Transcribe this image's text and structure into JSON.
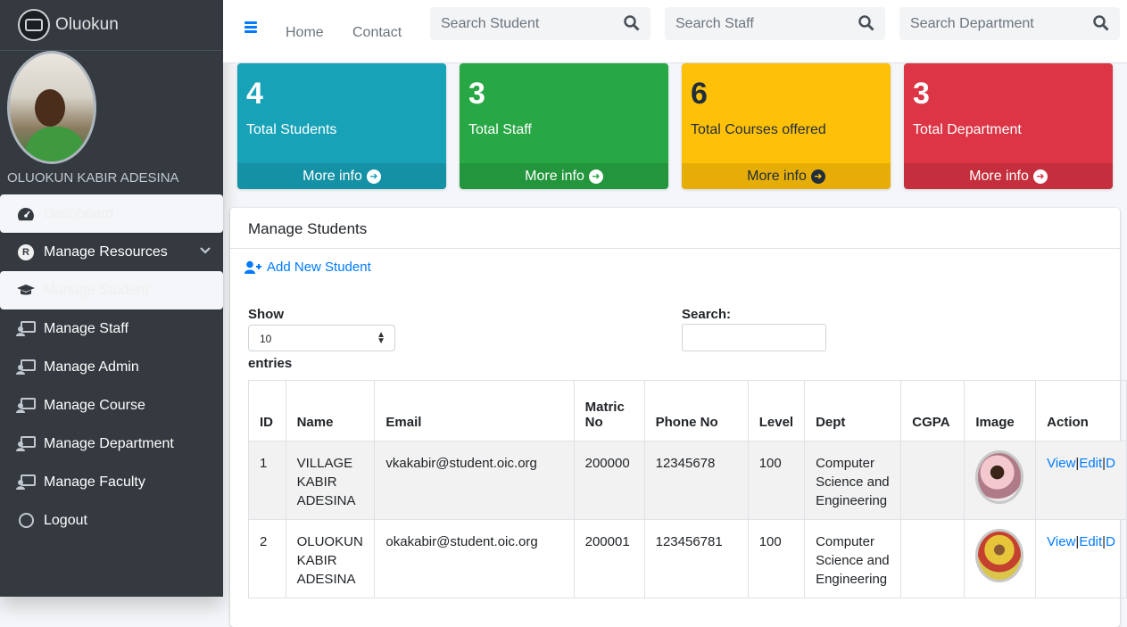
{
  "brand": {
    "name": "Oluokun"
  },
  "user": {
    "name": "OLUOKUN KABIR ADESINA"
  },
  "sidebar": {
    "items": [
      {
        "label": "Dashboard",
        "icon": "dashboard-icon"
      },
      {
        "label": "Manage Resources",
        "icon": "r-circle-icon"
      },
      {
        "label": "Manage Student",
        "icon": "graduation-cap-icon"
      },
      {
        "label": "Manage Staff",
        "icon": "chalkboard-user-icon"
      },
      {
        "label": "Manage Admin",
        "icon": "chalkboard-user-icon"
      },
      {
        "label": "Manage Course",
        "icon": "chalkboard-user-icon"
      },
      {
        "label": "Manage Department",
        "icon": "chalkboard-user-icon"
      },
      {
        "label": "Manage Faculty",
        "icon": "chalkboard-user-icon"
      },
      {
        "label": "Logout",
        "icon": "circle-icon"
      }
    ]
  },
  "topbar": {
    "links": [
      "Home",
      "Contact"
    ],
    "search_student": "Search Student",
    "search_staff": "Search Staff",
    "search_department": "Search Department"
  },
  "stats": [
    {
      "value": "4",
      "label": "Total Students",
      "more": "More info",
      "color": "#17a2b8"
    },
    {
      "value": "3",
      "label": "Total Staff",
      "more": "More info",
      "color": "#28a745"
    },
    {
      "value": "6",
      "label": "Total Courses offered",
      "more": "More info",
      "color": "#ffc107"
    },
    {
      "value": "3",
      "label": "Total Department",
      "more": "More info",
      "color": "#dc3545"
    }
  ],
  "card": {
    "title": "Manage Students",
    "add_label": "Add New Student",
    "show_label": "Show",
    "entries_label": "entries",
    "page_size": "10",
    "search_label": "Search:"
  },
  "table": {
    "headers": [
      "ID",
      "Name",
      "Email",
      "Matric No",
      "Phone No",
      "Level",
      "Dept",
      "CGPA",
      "Image",
      "Action"
    ],
    "rows": [
      {
        "id": "1",
        "name": "VILLAGE KABIR ADESINA",
        "email": "vkakabir@student.oic.org",
        "matric": "200000",
        "phone": "12345678",
        "level": "100",
        "dept": "Computer Science and Engineering",
        "cgpa": ""
      },
      {
        "id": "2",
        "name": "OLUOKUN KABIR ADESINA",
        "email": "okakabir@student.oic.org",
        "matric": "200001",
        "phone": "123456781",
        "level": "100",
        "dept": "Computer Science and Engineering",
        "cgpa": ""
      }
    ],
    "actions": {
      "view": "View",
      "edit": "Edit",
      "delete": "D",
      "sep": "|"
    }
  }
}
